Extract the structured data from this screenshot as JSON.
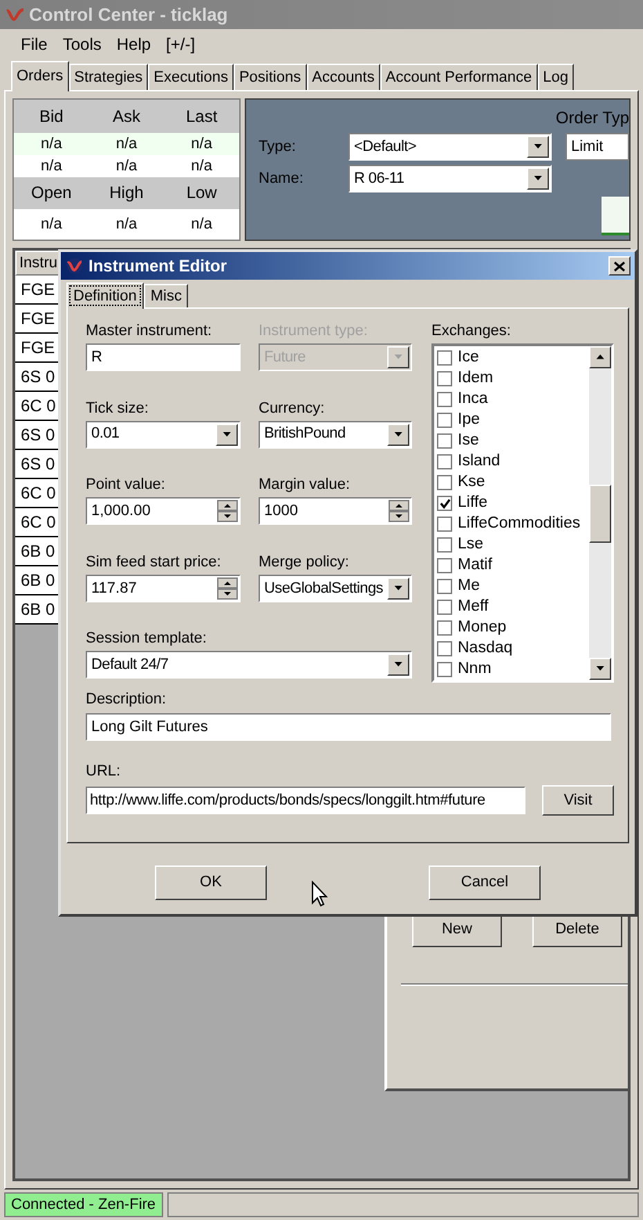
{
  "window": {
    "title": "Control Center - ticklag"
  },
  "menu": [
    "File",
    "Tools",
    "Help",
    "[+/-]"
  ],
  "tabs": [
    {
      "label": "Orders",
      "selected": true
    },
    {
      "label": "Strategies",
      "selected": false
    },
    {
      "label": "Executions",
      "selected": false
    },
    {
      "label": "Positions",
      "selected": false
    },
    {
      "label": "Accounts",
      "selected": false
    },
    {
      "label": "Account Performance",
      "selected": false
    },
    {
      "label": "Log",
      "selected": false
    }
  ],
  "quotes": {
    "top_headers": [
      "Bid",
      "Ask",
      "Last"
    ],
    "top_rows": [
      [
        "n/a",
        "n/a",
        "n/a"
      ],
      [
        "n/a",
        "n/a",
        "n/a"
      ]
    ],
    "bottom_headers": [
      "Open",
      "High",
      "Low"
    ],
    "bottom_rows": [
      [
        "n/a",
        "n/a",
        "n/a"
      ]
    ]
  },
  "order_panel": {
    "order_type_label": "Order Typ",
    "type_label": "Type:",
    "type_value": "<Default>",
    "order_type_value": "Limit",
    "name_label": "Name:",
    "name_value": "R 06-11"
  },
  "grid": {
    "column": "Instru",
    "rows": [
      "FGE",
      "FGE",
      "FGE",
      "6S 0",
      "6C 0",
      "6S 0",
      "6S 0",
      "6C 0",
      "6C 0",
      "6B 0",
      "6B 0",
      "6B 0"
    ]
  },
  "side_buttons": [
    "New",
    "Delete"
  ],
  "dialog": {
    "title": "Instrument Editor",
    "tabs": [
      {
        "label": "Definition",
        "selected": true
      },
      {
        "label": "Misc",
        "selected": false
      }
    ],
    "fields": [
      {
        "label": "Master instrument:",
        "value": "R",
        "kind": "text",
        "disabled": false
      },
      {
        "label": "Instrument type:",
        "value": "Future",
        "kind": "combo",
        "disabled": true
      },
      {
        "label": "Tick size:",
        "value": "0.01",
        "kind": "combo",
        "disabled": false
      },
      {
        "label": "Currency:",
        "value": "BritishPound",
        "kind": "combo",
        "disabled": false
      },
      {
        "label": "Point value:",
        "value": "1,000.00",
        "kind": "spin",
        "disabled": false
      },
      {
        "label": "Margin value:",
        "value": "1000",
        "kind": "spin",
        "disabled": false
      },
      {
        "label": "Sim feed start price:",
        "value": "117.87",
        "kind": "spin",
        "disabled": false
      },
      {
        "label": "Merge policy:",
        "value": "UseGlobalSettings",
        "kind": "combo",
        "disabled": false
      }
    ],
    "session_template": {
      "label": "Session template:",
      "value": "Default 24/7"
    },
    "exchanges_label": "Exchanges:",
    "exchanges": [
      {
        "label": "Ice",
        "checked": false
      },
      {
        "label": "Idem",
        "checked": false
      },
      {
        "label": "Inca",
        "checked": false
      },
      {
        "label": "Ipe",
        "checked": false
      },
      {
        "label": "Ise",
        "checked": false
      },
      {
        "label": "Island",
        "checked": false
      },
      {
        "label": "Kse",
        "checked": false
      },
      {
        "label": "Liffe",
        "checked": true
      },
      {
        "label": "LiffeCommodities",
        "checked": false
      },
      {
        "label": "Lse",
        "checked": false
      },
      {
        "label": "Matif",
        "checked": false
      },
      {
        "label": "Me",
        "checked": false
      },
      {
        "label": "Meff",
        "checked": false
      },
      {
        "label": "Monep",
        "checked": false
      },
      {
        "label": "Nasdaq",
        "checked": false
      },
      {
        "label": "Nnm",
        "checked": false
      }
    ],
    "description": {
      "label": "Description:",
      "value": "Long Gilt Futures"
    },
    "url": {
      "label": "URL:",
      "value": "http://www.liffe.com/products/bonds/specs/longgilt.htm#future"
    },
    "visit_button": "Visit",
    "buttons": [
      "OK",
      "Cancel"
    ]
  },
  "status_bar": {
    "text": "Connected - Zen-Fire"
  }
}
